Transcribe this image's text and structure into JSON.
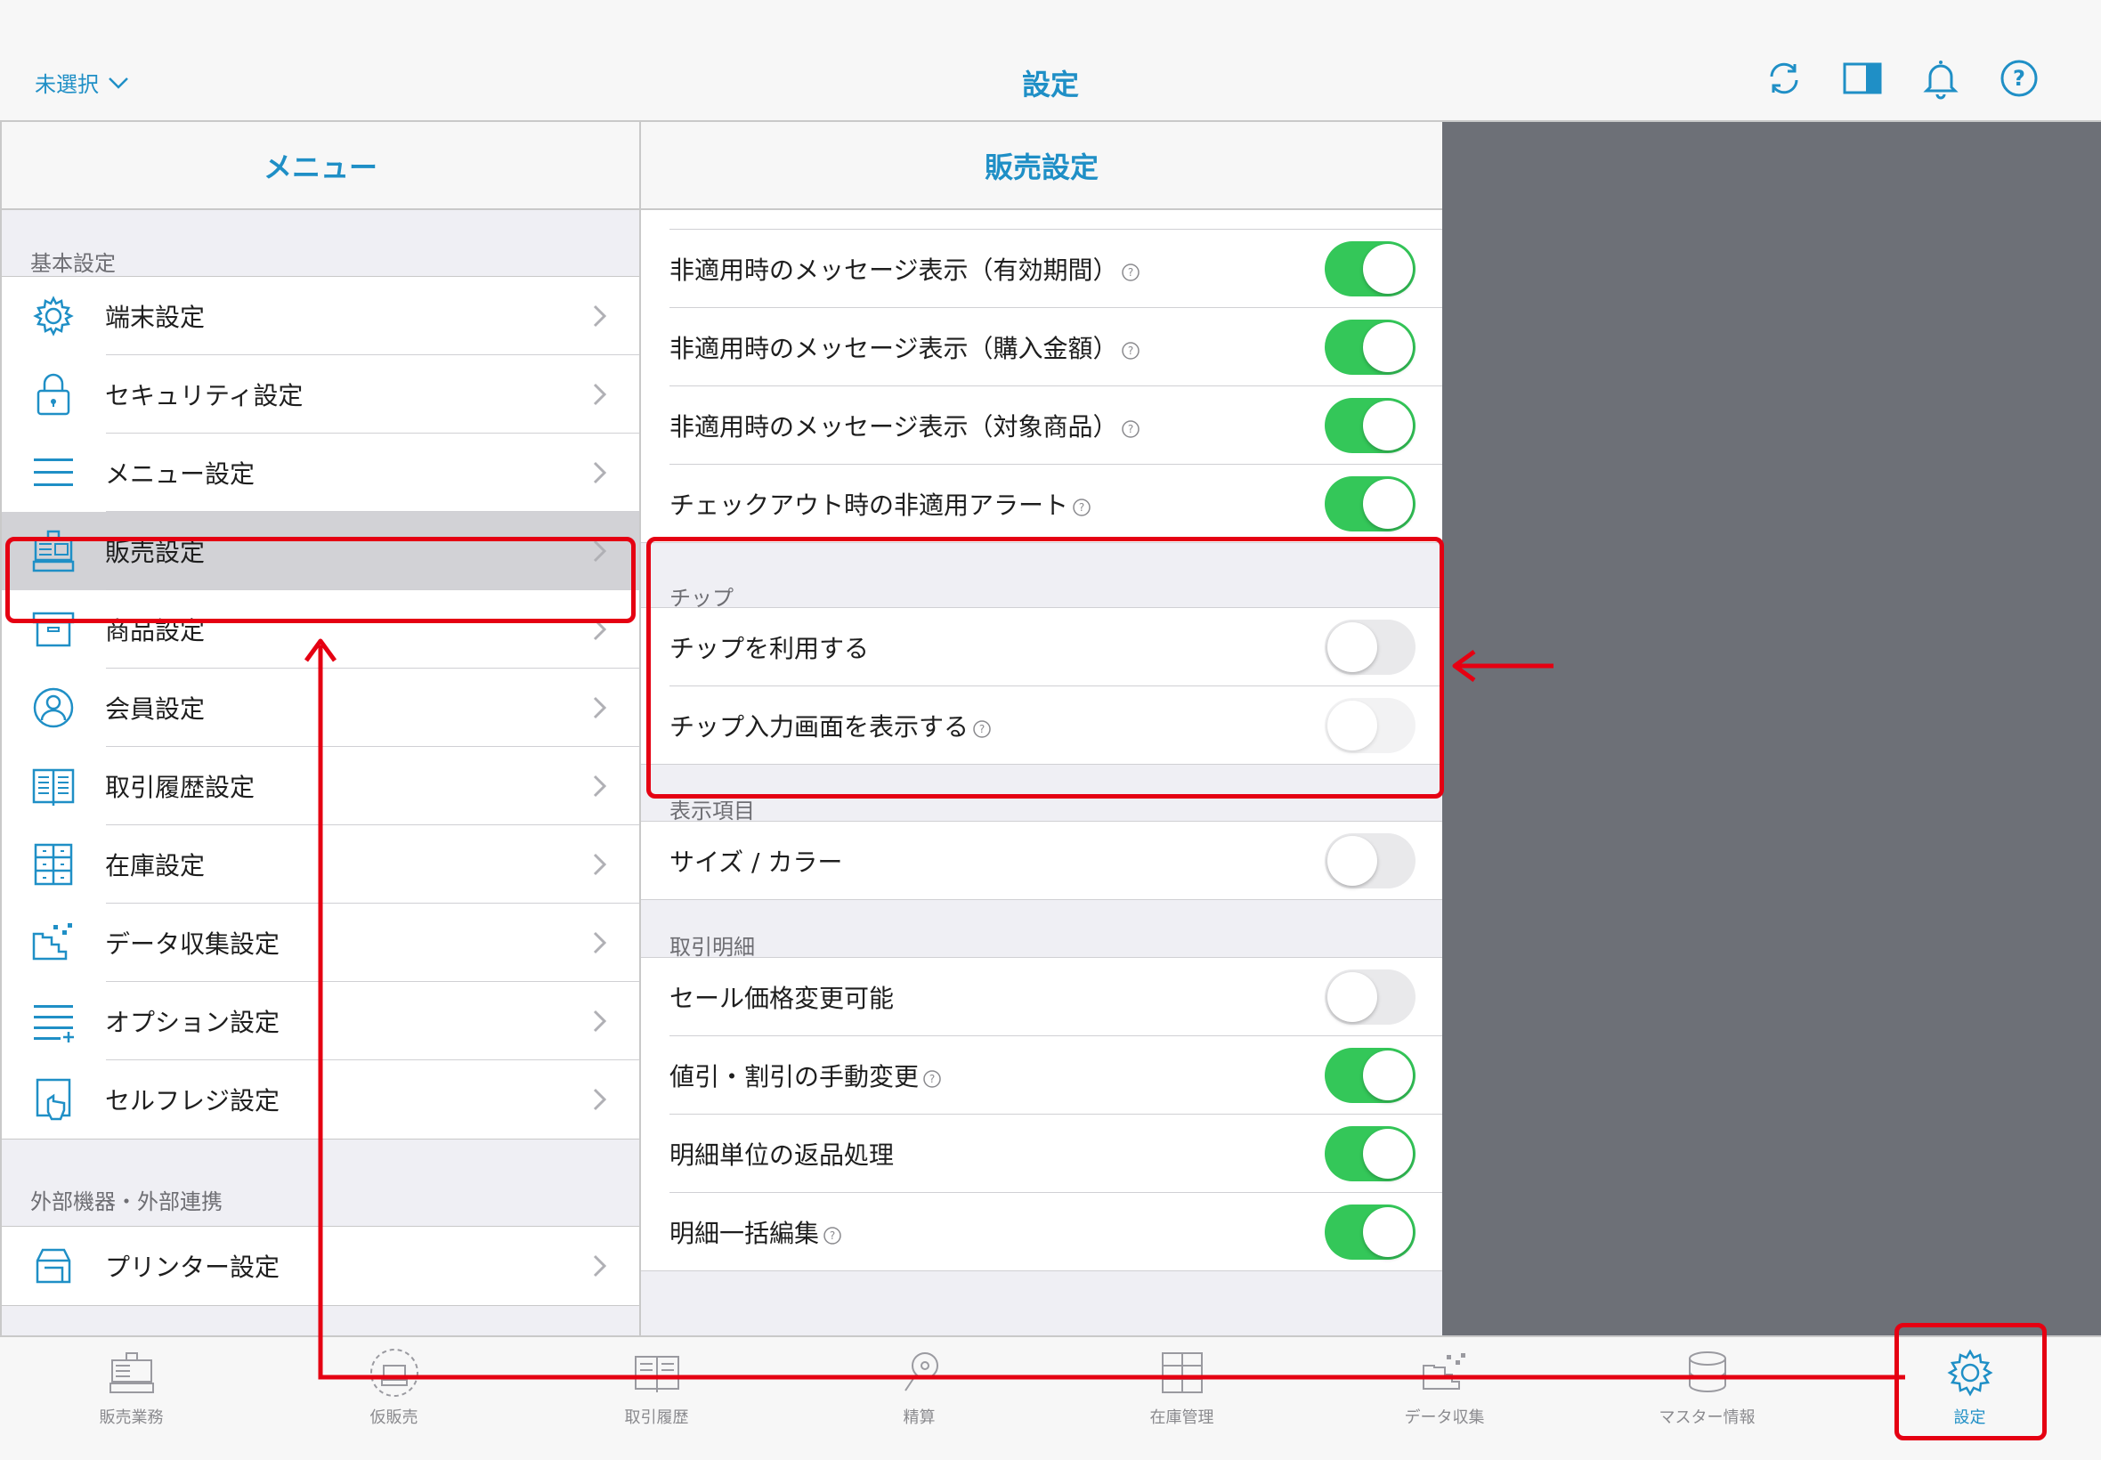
{
  "topbar": {
    "selector_label": "未選択",
    "title": "設定",
    "icons": [
      "sync-icon",
      "split-view-icon",
      "bell-icon",
      "help-icon"
    ]
  },
  "menu": {
    "title": "メニュー",
    "section_basic": "基本設定",
    "items": [
      {
        "label": "端末設定",
        "icon": "gear-icon"
      },
      {
        "label": "セキュリティ設定",
        "icon": "lock-icon"
      },
      {
        "label": "メニュー設定",
        "icon": "list-icon"
      },
      {
        "label": "販売設定",
        "icon": "register-icon",
        "selected": true
      },
      {
        "label": "商品設定",
        "icon": "box-icon"
      },
      {
        "label": "会員設定",
        "icon": "person-icon"
      },
      {
        "label": "取引履歴設定",
        "icon": "book-icon"
      },
      {
        "label": "在庫設定",
        "icon": "shelves-icon"
      },
      {
        "label": "データ収集設定",
        "icon": "data-icon"
      },
      {
        "label": "オプション設定",
        "icon": "list-plus-icon"
      },
      {
        "label": "セルフレジ設定",
        "icon": "selfreg-icon"
      }
    ],
    "section_external": "外部機器・外部連携",
    "external_items": [
      {
        "label": "プリンター設定",
        "icon": "printer-icon"
      }
    ]
  },
  "detail": {
    "title": "販売設定",
    "top_rows": [
      {
        "label": "非適用時のメッセージ表示（有効期間）",
        "help": true,
        "on": true
      },
      {
        "label": "非適用時のメッセージ表示（購入金額）",
        "help": true,
        "on": true
      },
      {
        "label": "非適用時のメッセージ表示（対象商品）",
        "help": true,
        "on": true
      },
      {
        "label": "チェックアウト時の非適用アラート",
        "help": true,
        "on": true
      }
    ],
    "tip_section": "チップ",
    "tip_rows": [
      {
        "label": "チップを利用する",
        "help": false,
        "on": false
      },
      {
        "label": "チップ入力画面を表示する",
        "help": true,
        "on": false,
        "disabled": true
      }
    ],
    "display_section": "表示項目",
    "display_rows": [
      {
        "label": "サイズ / カラー",
        "help": false,
        "on": false
      }
    ],
    "txn_section": "取引明細",
    "txn_rows": [
      {
        "label": "セール価格変更可能",
        "help": false,
        "on": false
      },
      {
        "label": "値引・割引の手動変更",
        "help": true,
        "on": true
      },
      {
        "label": "明細単位の返品処理",
        "help": false,
        "on": true
      },
      {
        "label": "明細一括編集",
        "help": true,
        "on": true
      }
    ]
  },
  "tabbar": {
    "tabs": [
      {
        "label": "販売業務",
        "icon": "register-icon"
      },
      {
        "label": "仮販売",
        "icon": "temp-sale-icon"
      },
      {
        "label": "取引履歴",
        "icon": "book-icon"
      },
      {
        "label": "精算",
        "icon": "settle-icon"
      },
      {
        "label": "在庫管理",
        "icon": "shelves-icon"
      },
      {
        "label": "データ収集",
        "icon": "data-icon"
      },
      {
        "label": "マスター情報",
        "icon": "database-icon"
      },
      {
        "label": "設定",
        "icon": "gear-icon",
        "selected": true
      }
    ]
  },
  "colors": {
    "accent": "#1f8fc6",
    "toggle_on": "#34c759",
    "annotation": "#e50012",
    "side_panel": "#6d7077"
  }
}
